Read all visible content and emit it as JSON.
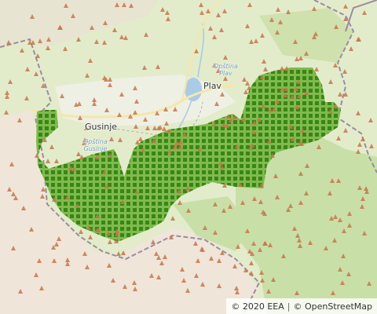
{
  "map": {
    "places": [
      {
        "name": "Plav",
        "key": "plav"
      },
      {
        "name": "Gusinje",
        "key": "gusinje"
      }
    ],
    "municipalities": [
      {
        "line1": "Opština",
        "line2": "Plav",
        "key": "opstina-plav"
      },
      {
        "line1": "Opština",
        "line2": "Gusinje",
        "key": "opstina-gusinje"
      }
    ],
    "colors": {
      "land": "#e2eccb",
      "forest": "#c9dfa8",
      "valley": "#eef0e4",
      "bare": "#efe5d8",
      "water": "#aacbe8",
      "road": "#f4e7a8",
      "border": "#9e8aa3",
      "area_fill": "#7fba4f",
      "area_grid": "#2d7d0a",
      "peak": "#c9754b"
    },
    "icons": [
      "peak-icon"
    ],
    "attribution": {
      "eea": "© 2020 EEA",
      "separator": "|",
      "osm": "© OpenStreetMap"
    }
  }
}
